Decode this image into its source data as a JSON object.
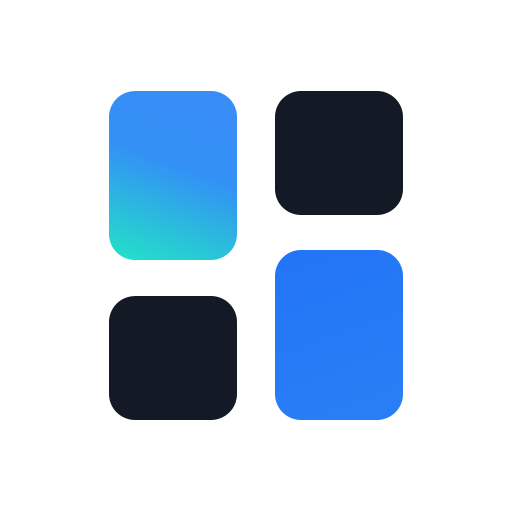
{
  "icon": {
    "name": "app-grid-logo",
    "tiles": [
      {
        "id": "top-left",
        "style": "gradient",
        "colors": [
          "#23e3c7",
          "#3a8cf7"
        ]
      },
      {
        "id": "top-right",
        "style": "solid",
        "colors": [
          "#131a26"
        ]
      },
      {
        "id": "bottom-left",
        "style": "solid",
        "colors": [
          "#131a26"
        ]
      },
      {
        "id": "bottom-right",
        "style": "gradient",
        "colors": [
          "#2274f6",
          "#2a7ff5"
        ]
      }
    ],
    "background": "#ffffff"
  }
}
